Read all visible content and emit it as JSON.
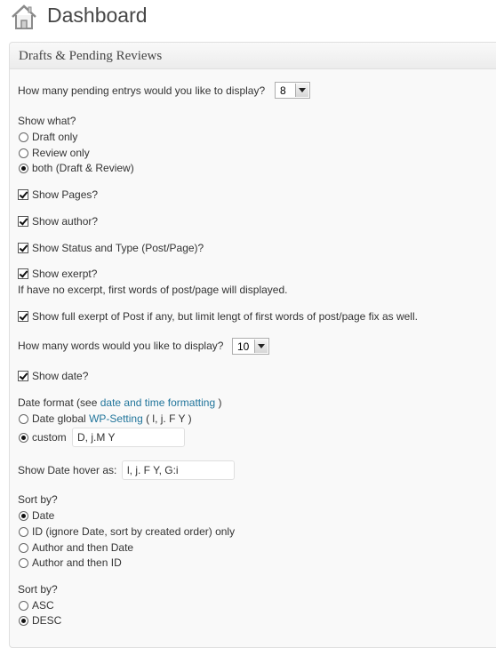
{
  "header": {
    "title": "Dashboard",
    "icon": "house-icon"
  },
  "widget": {
    "title": "Drafts & Pending Reviews",
    "pending_count_label": "How many pending entrys would you like to display?",
    "pending_count_value": "8",
    "show_what": {
      "label": "Show what?",
      "options": [
        "Draft only",
        "Review only",
        "both (Draft & Review)"
      ],
      "selected": "both (Draft & Review)"
    },
    "show_pages": {
      "label": "Show Pages?",
      "checked": true
    },
    "show_author": {
      "label": "Show author?",
      "checked": true
    },
    "show_status": {
      "label": "Show Status and Type (Post/Page)?",
      "checked": true
    },
    "show_excerpt": {
      "label": "Show exerpt?",
      "checked": true,
      "note": "If have no excerpt, first words of post/page will displayed."
    },
    "show_full_excerpt": {
      "label": "Show full exerpt of Post if any, but limit lengt of first words of post/page fix as well.",
      "checked": true
    },
    "words_count_label": "How many words would you like to display?",
    "words_count_value": "10",
    "show_date": {
      "label": "Show date?",
      "checked": true
    },
    "date_format": {
      "label_prefix": "Date format (see",
      "link_text": "date and time formatting",
      "label_suffix": ")",
      "global_prefix": "Date global",
      "global_link": "WP-Setting",
      "global_suffix": "( l, j. F Y )",
      "custom_label": "custom",
      "custom_value": "D, j.M Y",
      "selected": "custom"
    },
    "date_hover": {
      "label": "Show Date hover as:",
      "value": "l, j. F Y, G:i"
    },
    "sort_by": {
      "label": "Sort by?",
      "options": [
        "Date",
        "ID (ignore Date, sort by created order) only",
        "Author and then Date",
        "Author and then ID"
      ],
      "selected": "Date"
    },
    "sort_order": {
      "label": "Sort by?",
      "options": [
        "ASC",
        "DESC"
      ],
      "selected": "DESC"
    }
  },
  "colors": {
    "link": "#21759b",
    "text": "#333333",
    "title": "#464646",
    "panel_bg": "#f9f9f9",
    "border": "#dfdfdf"
  }
}
